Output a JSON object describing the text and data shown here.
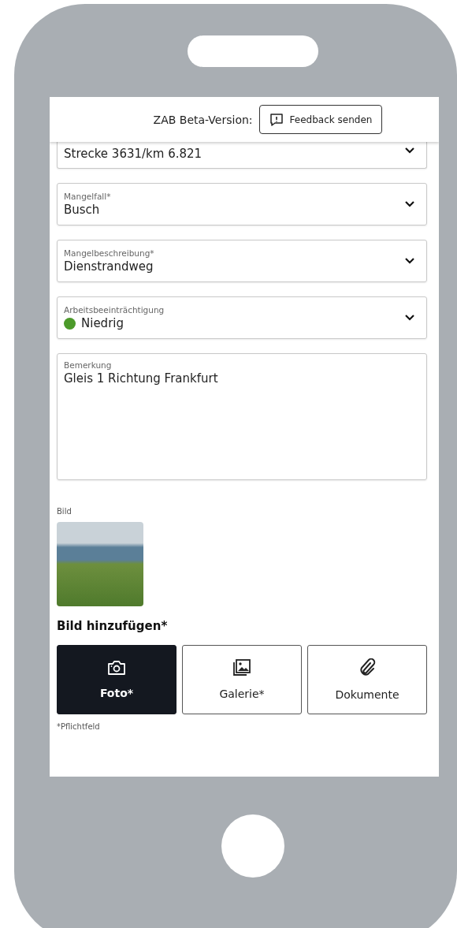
{
  "header": {
    "label": "ZAB Beta-Version:",
    "feedback_button": "Feedback senden"
  },
  "fields": [
    {
      "kind": "select",
      "value": "Strecke 3631/km 6.821",
      "cut": true
    },
    {
      "kind": "select",
      "label": "Mangelfall*",
      "value": "Busch"
    },
    {
      "kind": "select",
      "label": "Mangelbeschreibung*",
      "value": "Dienstrandweg"
    },
    {
      "kind": "select",
      "label": "Arbeitsbeeinträchtigung",
      "value": "Niedrig",
      "color": "#4c9a2a"
    },
    {
      "kind": "textarea",
      "label": "Bemerkung",
      "value": "Gleis 1 Richtung Frankfurt"
    }
  ],
  "image_section": {
    "label": "Bild"
  },
  "add_image": {
    "title": "Bild hinzufügen*",
    "buttons": [
      {
        "kind": "camera",
        "label": "Foto*",
        "selected": true
      },
      {
        "kind": "gallery",
        "label": "Galerie*",
        "selected": false
      },
      {
        "kind": "attachment",
        "label": "Dokumente",
        "selected": false
      }
    ]
  },
  "footnote": "*Pflichtfeld"
}
